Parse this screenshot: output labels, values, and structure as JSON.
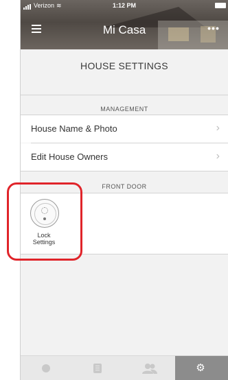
{
  "status_bar": {
    "carrier": "Verizon",
    "time": "1:12 PM"
  },
  "header": {
    "title": "Mi Casa",
    "more_label": "•••"
  },
  "page": {
    "title": "HOUSE SETTINGS"
  },
  "management": {
    "section_label": "MANAGEMENT",
    "items": [
      {
        "label": "House Name & Photo",
        "chevron": "›"
      },
      {
        "label": "Edit House Owners",
        "chevron": "›"
      }
    ]
  },
  "front_door": {
    "section_label": "FRONT DOOR",
    "lock_caption_line1": "Lock",
    "lock_caption_line2": "Settings"
  },
  "tab_bar": {
    "tabs": [
      "home-icon",
      "activity-icon",
      "guests-icon",
      "settings-icon"
    ],
    "active_index": 3,
    "gear_glyph": "⚙"
  },
  "colors": {
    "highlight": "#e0242a",
    "active_tab": "#8c8c8c",
    "background": "#f2f2f2"
  }
}
